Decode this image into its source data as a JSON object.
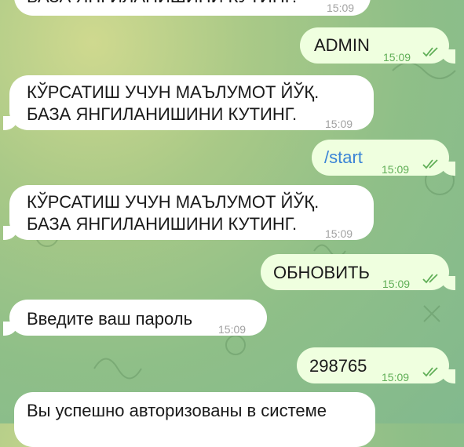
{
  "messages": [
    {
      "direction": "in",
      "text": "БАЗА ЯНГИЛАНИШИНИ КУТИНГ.",
      "time": "15:09"
    },
    {
      "direction": "out",
      "text": "ADMIN",
      "time": "15:09",
      "status": "read"
    },
    {
      "direction": "in",
      "line1": "КЎРСАТИШ УЧУН МАЪЛУМОТ ЙЎҚ.",
      "line2": "БАЗА ЯНГИЛАНИШИНИ КУТИНГ.",
      "time": "15:09"
    },
    {
      "direction": "out",
      "text": "/start",
      "time": "15:09",
      "status": "read"
    },
    {
      "direction": "in",
      "line1": "КЎРСАТИШ УЧУН МАЪЛУМОТ ЙЎҚ.",
      "line2": "БАЗА ЯНГИЛАНИШИНИ КУТИНГ.",
      "time": "15:09"
    },
    {
      "direction": "out",
      "text": "ОБНОВИТЬ",
      "time": "15:09",
      "status": "read"
    },
    {
      "direction": "in",
      "text": "Введите ваш пароль",
      "time": "15:09"
    },
    {
      "direction": "out",
      "text": "298765",
      "time": "15:09",
      "status": "read"
    },
    {
      "direction": "in",
      "text": "Вы успешно авторизованы в системе"
    }
  ],
  "colors": {
    "incoming_bubble": "#ffffff",
    "outgoing_bubble": "#efffdf",
    "outgoing_time": "#5fae56",
    "incoming_time": "#a2a2a2",
    "link": "#3a84d6"
  },
  "icons": [
    "double-check-icon"
  ]
}
